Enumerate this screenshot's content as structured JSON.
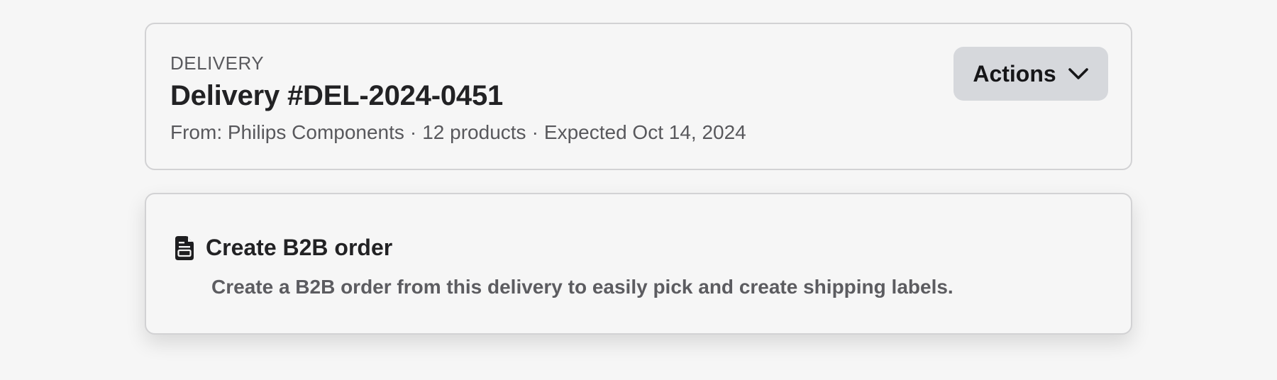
{
  "delivery_header": {
    "eyebrow": "DELIVERY",
    "title": "Delivery #DEL-2024-0451",
    "meta": {
      "from": "From: Philips Components",
      "products": "12 products",
      "expected": "Expected Oct 14, 2024",
      "separator": "·"
    },
    "actions_label": "Actions",
    "actions_icon": "chevron-down-icon"
  },
  "b2b_card": {
    "icon": "document-icon",
    "title": "Create B2B order",
    "description": "Create a B2B order from this delivery to easily pick and create shipping labels."
  }
}
